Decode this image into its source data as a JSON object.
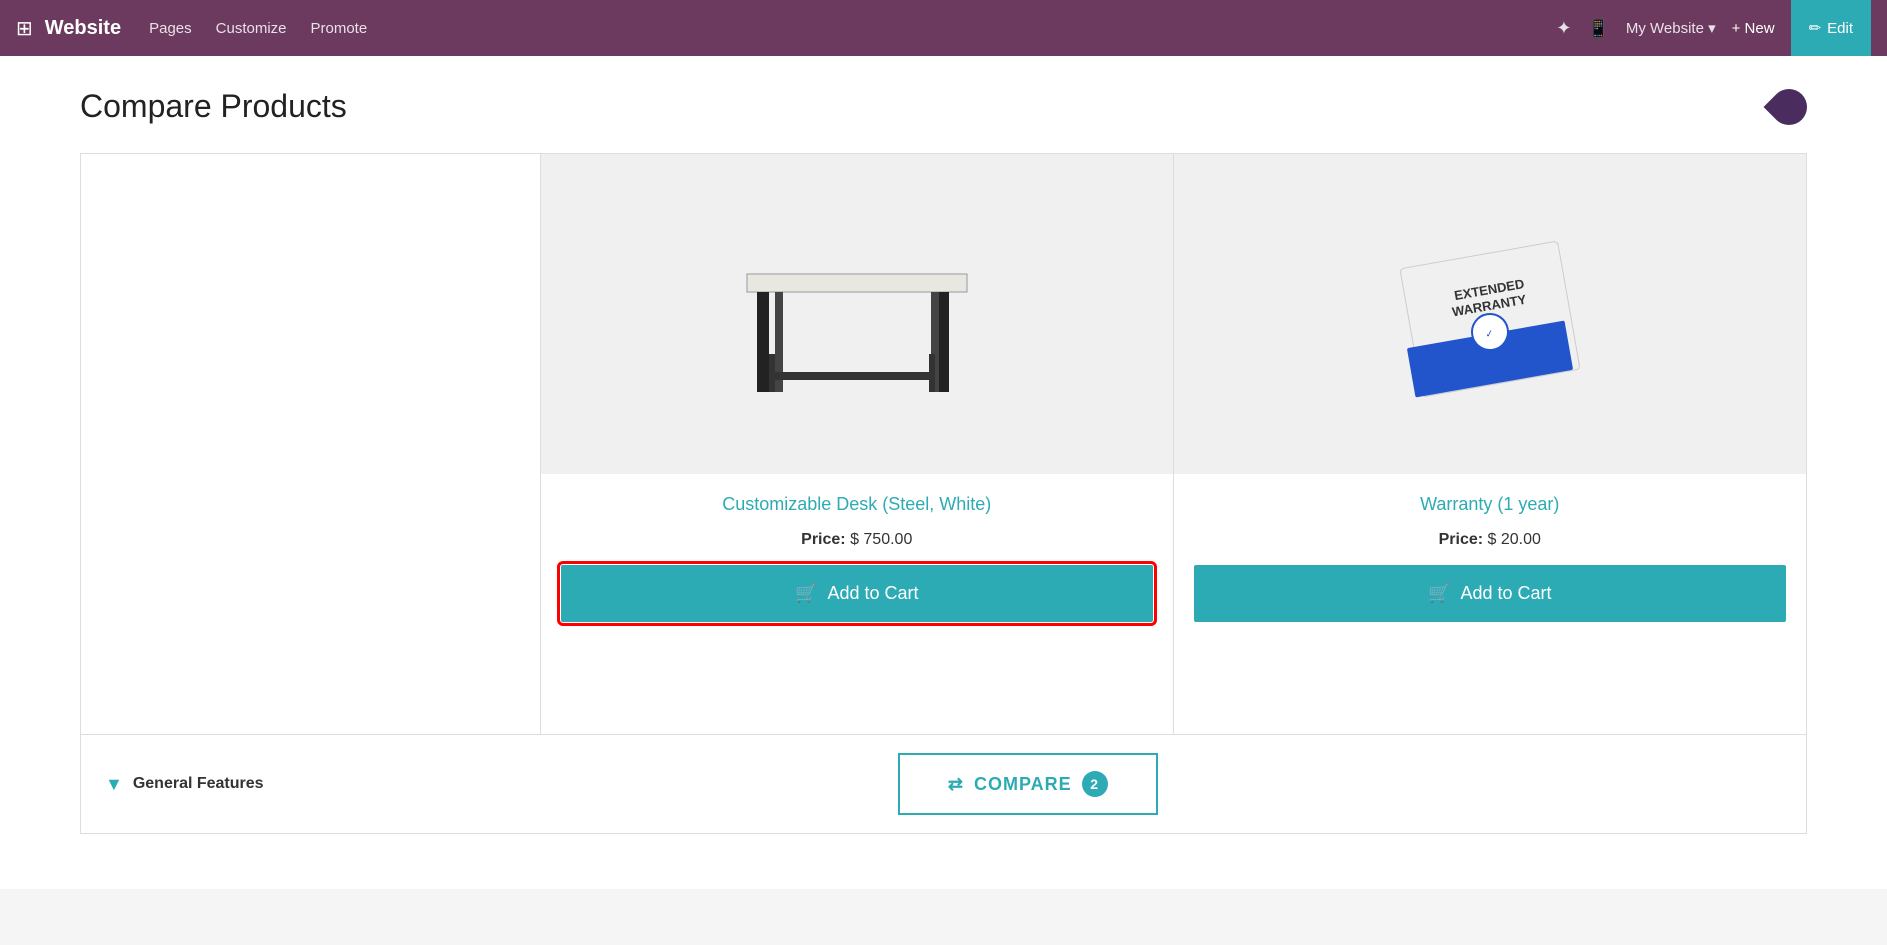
{
  "nav": {
    "brand": "Website",
    "links": [
      "Pages",
      "Customize",
      "Promote"
    ],
    "my_website_label": "My Website ▾",
    "new_label": "+ New",
    "edit_label": "Edit"
  },
  "page": {
    "title": "Compare Products"
  },
  "products": [
    {
      "id": "product-1",
      "name": "Customizable Desk (Steel, White)",
      "price_label": "Price:",
      "price": "$ 750.00",
      "add_to_cart": "Add to Cart",
      "highlighted": true
    },
    {
      "id": "product-2",
      "name": "Warranty (1 year)",
      "price_label": "Price:",
      "price": "$ 20.00",
      "add_to_cart": "Add to Cart",
      "highlighted": false
    }
  ],
  "general_features": {
    "label": "General Features"
  },
  "compare_button": {
    "label": "COMPARE",
    "count": "2"
  }
}
